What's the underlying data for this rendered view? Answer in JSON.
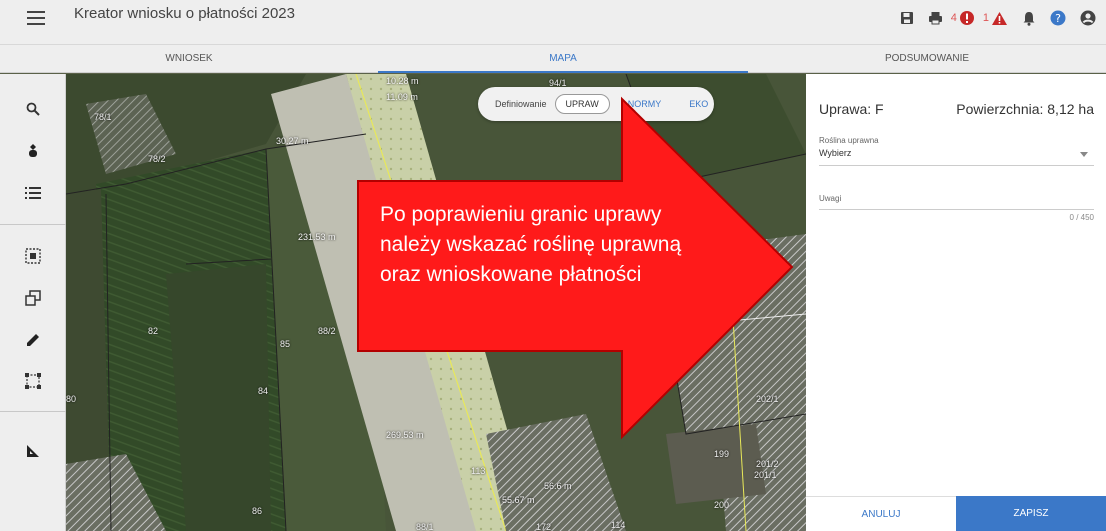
{
  "app": {
    "title": "Kreator wniosku o płatności 2023",
    "notifications": {
      "warnings_count": "4",
      "errors_count": "1"
    }
  },
  "tabs": [
    {
      "label": "WNIOSEK"
    },
    {
      "label": "MAPA"
    },
    {
      "label": "PODSUMOWANIE"
    }
  ],
  "map": {
    "definiowanie_label": "Definiowanie",
    "mode_buttons": [
      "UPRAW",
      "NORMY",
      "EKO"
    ],
    "parcel_labels": [
      "78/1",
      "78/2",
      "82",
      "85",
      "88/2",
      "84",
      "80",
      "86",
      "88/1",
      "94/1",
      "113",
      "114",
      "172",
      "199",
      "200",
      "201/2",
      "201/1",
      "202/1"
    ],
    "measurements": [
      "10.28 m",
      "11.09 m",
      "231.53 m",
      "269.53 m",
      "56.6 m",
      "55.67 m",
      "30.27 m"
    ]
  },
  "callout": {
    "text": "Po poprawieniu granic uprawy należy wskazać roślinę uprawną oraz wnioskowane płatności",
    "color": "#ff1a1a"
  },
  "panel": {
    "title": "Uprawa: F",
    "area": "Powierzchnia: 8,12 ha",
    "crop_label": "Roślina uprawna",
    "crop_value": "Wybierz",
    "notes_placeholder": "Uwagi",
    "notes_counter": "0 / 450",
    "cancel_label": "ANULUJ",
    "save_label": "ZAPISZ"
  },
  "colors": {
    "accent": "#3b78c8",
    "toolbar_bg": "#eeeeee"
  }
}
